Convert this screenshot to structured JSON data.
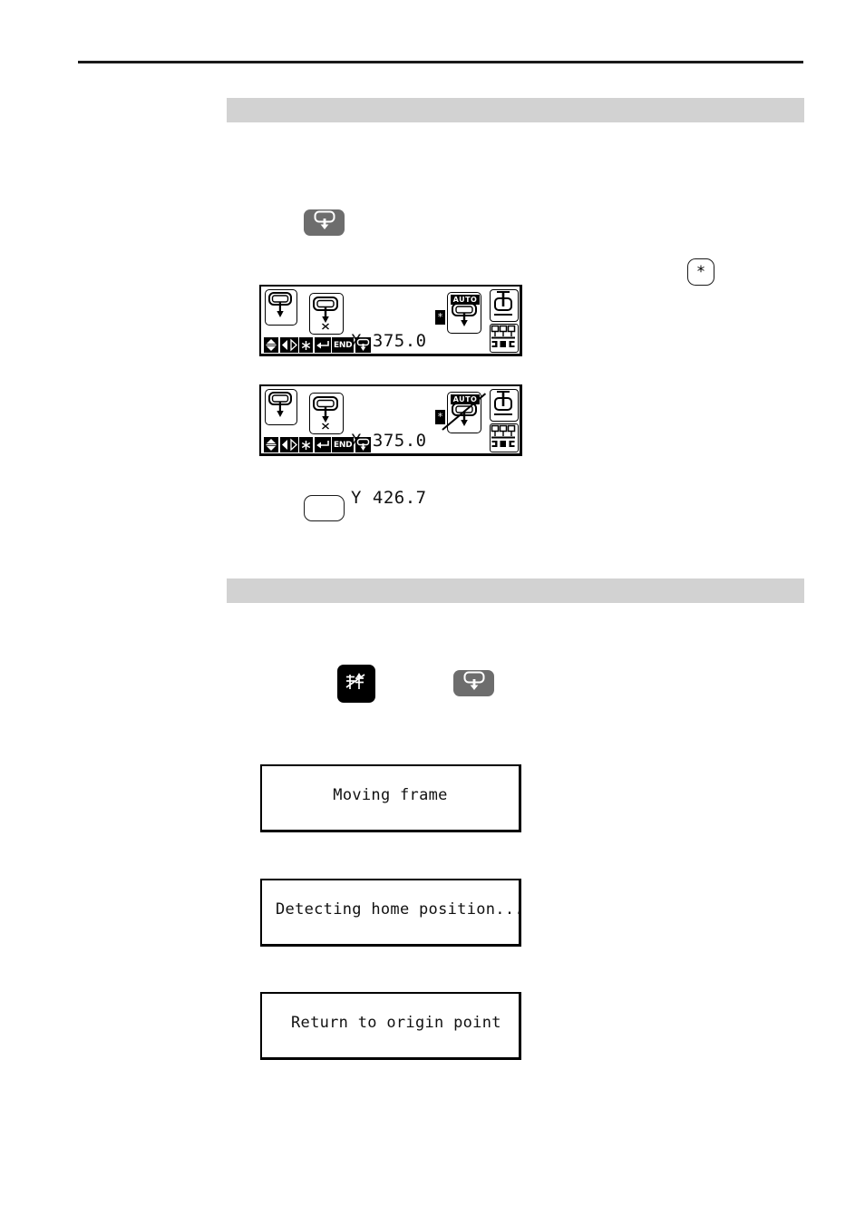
{
  "page": {
    "type": "manual-page-scan",
    "background_color": "#ffffff",
    "rule_color": "#1a1a1a"
  },
  "sections": {
    "bar_color": "#d2d2d2",
    "bar_1_heading": "",
    "bar_2_heading": ""
  },
  "buttons": {
    "presser_foot_1": {
      "icon": "presser-foot-down-icon",
      "label": "",
      "style": "gray",
      "color": "#6d6d6d"
    },
    "asterisk": {
      "icon": "asterisk-icon",
      "label": "*",
      "style": "white-outline",
      "color": "#ffffff"
    },
    "blank": {
      "icon": "",
      "label": "",
      "style": "white-outline",
      "color": "#ffffff"
    },
    "thread_trim": {
      "icon": "thread-trim-icon",
      "label": "",
      "style": "black",
      "color": "#000000"
    },
    "presser_foot_2": {
      "icon": "presser-foot-down-icon",
      "label": "",
      "style": "gray",
      "color": "#6d6d6d"
    }
  },
  "lcd_panels": [
    {
      "id": "status-panel-auto-enabled",
      "left_icon": "frame-down-icon",
      "frame_icon": "frame-origin-x-icon",
      "coord_x_label": "X",
      "coord_x_value": "375.0",
      "coord_y_label": "Y",
      "coord_y_value": "426.7",
      "asterisk_chip": "*",
      "auto_label": "AUTO",
      "auto_icon": "auto-presser-foot-icon",
      "auto_disabled": false,
      "right_icon_1": "needle-bar-icon",
      "right_icon_2": "thread-spools-icon",
      "statusbar": [
        {
          "name": "up-down-arrows-icon",
          "label": ""
        },
        {
          "name": "left-right-arrows-icon",
          "label": ""
        },
        {
          "name": "asterisk-icon",
          "label": ""
        },
        {
          "name": "enter-return-icon",
          "label": ""
        },
        {
          "name": "end-key",
          "label": "END"
        },
        {
          "name": "presser-foot-down-icon",
          "label": ""
        }
      ]
    },
    {
      "id": "status-panel-auto-disabled",
      "left_icon": "frame-down-icon",
      "frame_icon": "frame-origin-x-icon",
      "coord_x_label": "X",
      "coord_x_value": "375.0",
      "coord_y_label": "Y",
      "coord_y_value": "426.7",
      "asterisk_chip": "*",
      "auto_label": "AUTO",
      "auto_icon": "auto-presser-foot-icon",
      "auto_disabled": true,
      "right_icon_1": "needle-bar-icon",
      "right_icon_2": "thread-spools-icon",
      "statusbar": [
        {
          "name": "up-down-arrows-icon",
          "label": ""
        },
        {
          "name": "left-right-arrows-icon",
          "label": ""
        },
        {
          "name": "asterisk-icon",
          "label": ""
        },
        {
          "name": "enter-return-icon",
          "label": ""
        },
        {
          "name": "end-key",
          "label": "END"
        },
        {
          "name": "presser-foot-down-icon",
          "label": ""
        }
      ]
    }
  ],
  "messages": [
    {
      "id": "moving-frame",
      "text": "Moving frame",
      "align": "center"
    },
    {
      "id": "detecting-home-position",
      "text": "Detecting home position...",
      "align": "indent-1"
    },
    {
      "id": "return-to-origin-point",
      "text": "Return to origin point",
      "align": "indent-2"
    }
  ]
}
